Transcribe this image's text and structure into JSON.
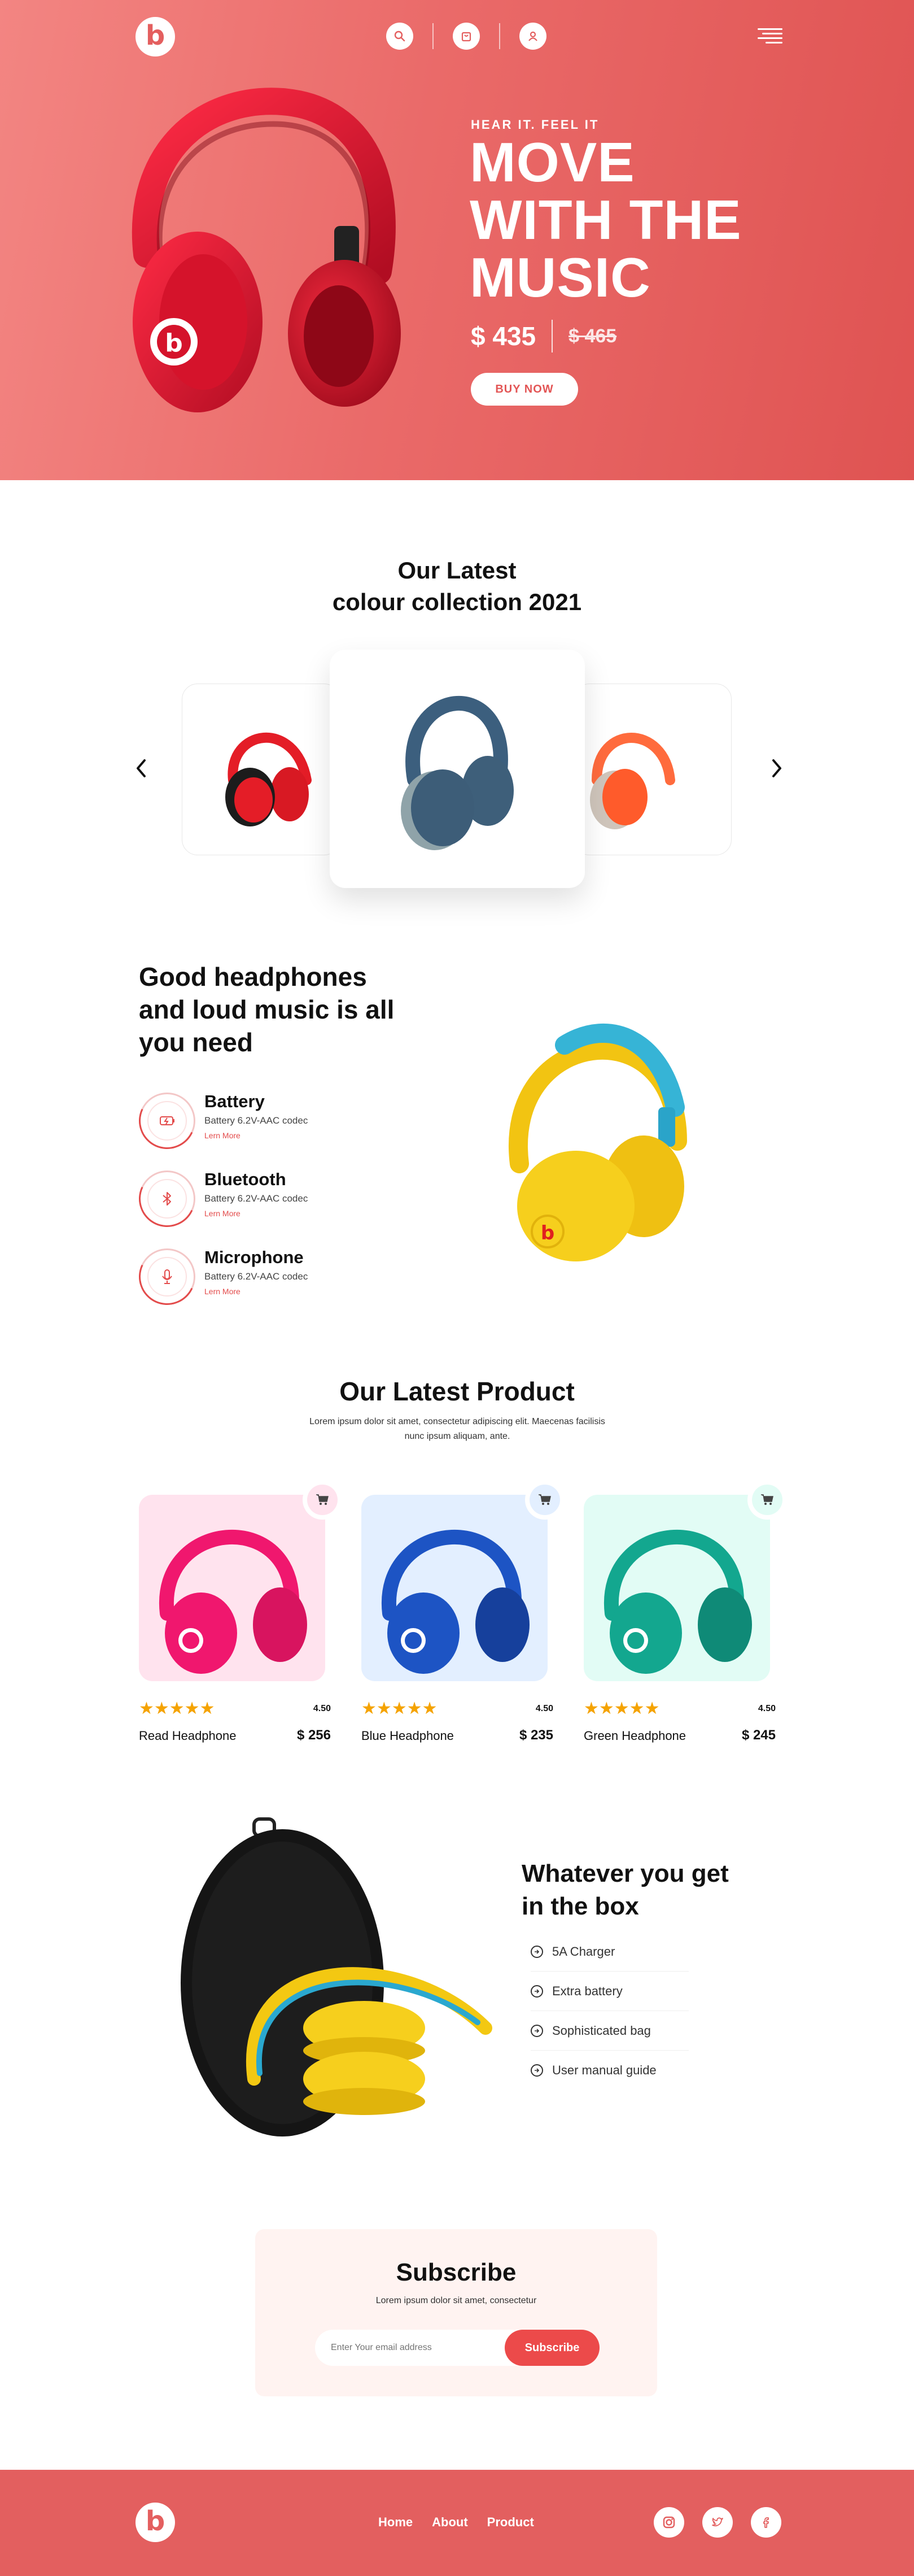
{
  "header": {
    "logo_letter": "b",
    "nav_icons": [
      "search-icon",
      "bag-icon",
      "user-icon"
    ],
    "menu_icon": "menu-icon"
  },
  "hero": {
    "eyebrow": "HEAR IT. FEEL IT",
    "title_lines": [
      "MOVE",
      "WITH THE",
      "MUSIC"
    ],
    "price": "$ 435",
    "old_price": "$ 465",
    "cta": "BUY NOW"
  },
  "collection": {
    "title_line1": "Our Latest",
    "title_line2": "colour collection 2021",
    "items": [
      "red headphones",
      "navy headphones",
      "orange headphones"
    ]
  },
  "features": {
    "title_lines": [
      "Good headphones",
      "and loud music is all",
      "you need"
    ],
    "items": [
      {
        "name": "Battery",
        "desc": "Battery 6.2V-AAC codec",
        "link": "Lern More",
        "icon": "battery-icon"
      },
      {
        "name": "Bluetooth",
        "desc": "Battery 6.2V-AAC codec",
        "link": "Lern More",
        "icon": "bluetooth-icon"
      },
      {
        "name": "Microphone",
        "desc": "Battery 6.2V-AAC codec",
        "link": "Lern More",
        "icon": "microphone-icon"
      }
    ]
  },
  "latest": {
    "title": "Our Latest Product",
    "desc": "Lorem ipsum dolor sit amet, consectetur adipiscing elit. Maecenas facilisis nunc ipsum aliquam, ante.",
    "products": [
      {
        "name": "Read Headphone",
        "price": "$ 256",
        "rating": "4.50",
        "stars": "★★★★★",
        "bg": "#ffe3ee",
        "accent": "#f0176e",
        "cart_bg": "#ffe3ee"
      },
      {
        "name": "Blue Headphone",
        "price": "$ 235",
        "rating": "4.50",
        "stars": "★★★★★",
        "bg": "#e3efff",
        "accent": "#1d54c4",
        "cart_bg": "#e3efff"
      },
      {
        "name": "Green Headphone",
        "price": "$ 245",
        "rating": "4.50",
        "stars": "★★★★★",
        "bg": "#e2fcf5",
        "accent": "#13a78f",
        "cart_bg": "#e2fcf5"
      }
    ]
  },
  "inbox": {
    "title_lines": [
      "Whatever you get",
      "in the box"
    ],
    "items": [
      "5A Charger",
      "Extra battery",
      "Sophisticated bag",
      "User manual guide"
    ]
  },
  "subscribe": {
    "title": "Subscribe",
    "desc": "Lorem ipsum dolor sit amet, consectetur",
    "placeholder": "Enter Your email address",
    "button": "Subscribe"
  },
  "footer": {
    "nav": [
      "Home",
      "About",
      "Product"
    ],
    "social": [
      "instagram-icon",
      "twitter-icon",
      "facebook-icon"
    ]
  },
  "colors": {
    "brand_red": "#e35f5f",
    "accent_red": "#ec4a4a",
    "star": "#f5a300"
  }
}
